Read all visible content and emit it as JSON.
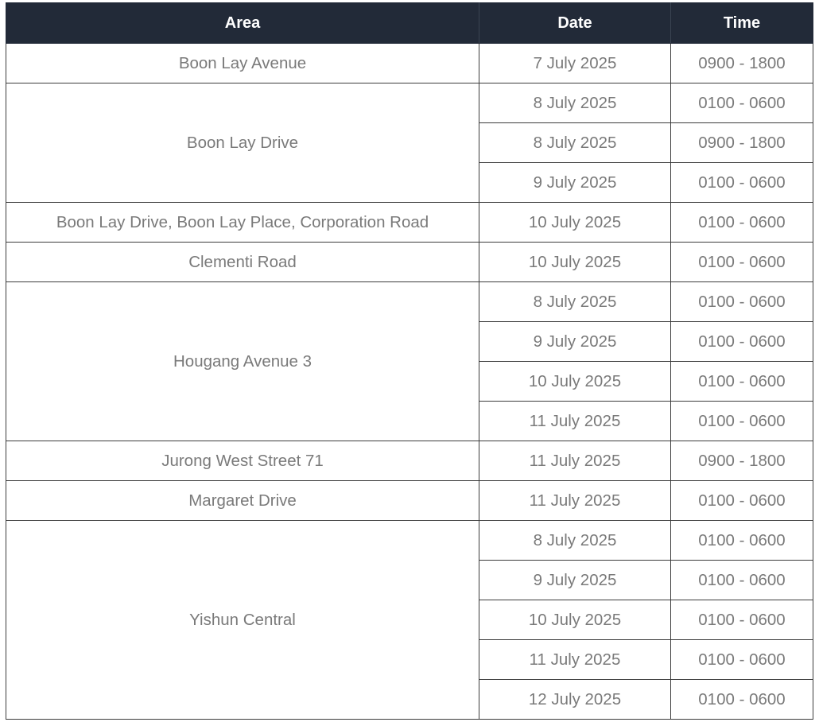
{
  "table": {
    "headers": {
      "area": "Area",
      "date": "Date",
      "time": "Time"
    },
    "groups": [
      {
        "area": "Boon Lay Avenue",
        "slots": [
          {
            "date": "7 July 2025",
            "time": "0900 - 1800"
          }
        ]
      },
      {
        "area": "Boon Lay Drive",
        "slots": [
          {
            "date": "8 July 2025",
            "time": "0100 - 0600"
          },
          {
            "date": "8 July 2025",
            "time": "0900 - 1800"
          },
          {
            "date": "9 July 2025",
            "time": "0100 - 0600"
          }
        ]
      },
      {
        "area": "Boon Lay Drive, Boon Lay Place, Corporation Road",
        "slots": [
          {
            "date": "10 July 2025",
            "time": "0100 - 0600"
          }
        ]
      },
      {
        "area": "Clementi Road",
        "slots": [
          {
            "date": "10 July 2025",
            "time": "0100 - 0600"
          }
        ]
      },
      {
        "area": "Hougang Avenue 3",
        "slots": [
          {
            "date": "8 July 2025",
            "time": "0100 - 0600"
          },
          {
            "date": "9 July 2025",
            "time": "0100 - 0600"
          },
          {
            "date": "10 July 2025",
            "time": "0100 - 0600"
          },
          {
            "date": "11 July 2025",
            "time": "0100 - 0600"
          }
        ]
      },
      {
        "area": "Jurong West Street 71",
        "slots": [
          {
            "date": "11 July 2025",
            "time": "0900 - 1800"
          }
        ]
      },
      {
        "area": "Margaret Drive",
        "slots": [
          {
            "date": "11 July 2025",
            "time": "0100 - 0600"
          }
        ]
      },
      {
        "area": "Yishun Central",
        "slots": [
          {
            "date": "8 July 2025",
            "time": "0100 - 0600"
          },
          {
            "date": "9 July 2025",
            "time": "0100 - 0600"
          },
          {
            "date": "10 July 2025",
            "time": "0100 - 0600"
          },
          {
            "date": "11 July 2025",
            "time": "0100 - 0600"
          },
          {
            "date": "12 July 2025",
            "time": "0100 - 0600"
          }
        ]
      }
    ]
  }
}
